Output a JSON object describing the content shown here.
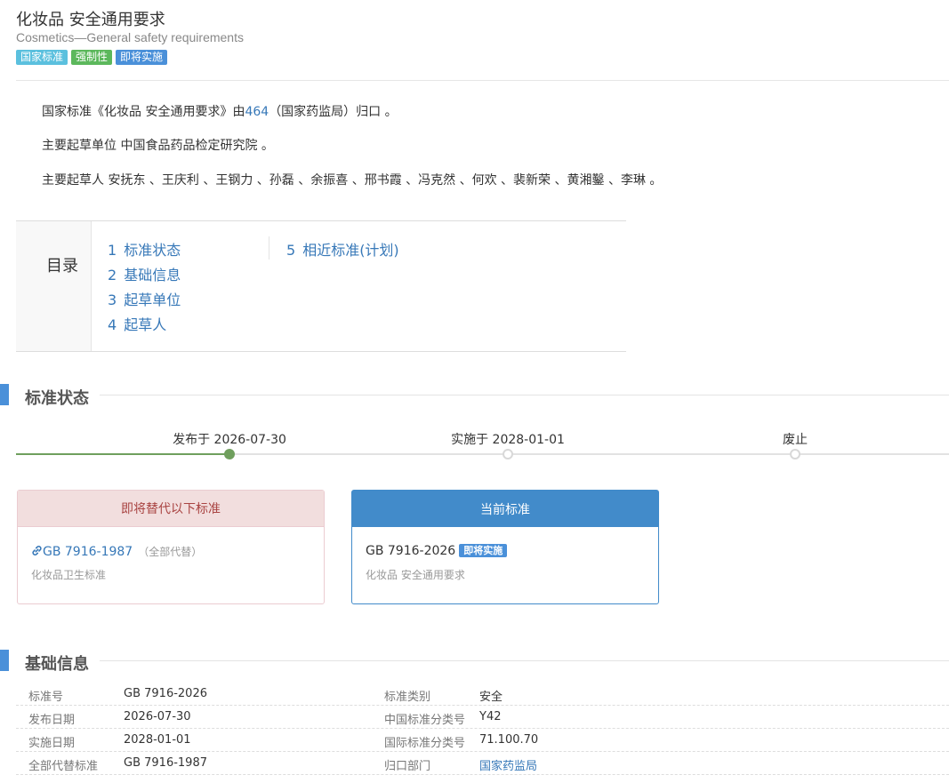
{
  "header": {
    "title": "化妆品 安全通用要求",
    "subtitle": "Cosmetics—General safety requirements",
    "badges": [
      {
        "label": "国家标准",
        "color": "#5bc0de"
      },
      {
        "label": "强制性",
        "color": "#5cb85c"
      },
      {
        "label": "即将实施",
        "color": "#4a90d9"
      }
    ]
  },
  "description": {
    "line1_prefix": "国家标准《化妆品 安全通用要求》由",
    "line1_link": "464",
    "line1_suffix": "（国家药监局）归口 。",
    "line2": "主要起草单位 中国食品药品检定研究院 。",
    "line3": "主要起草人 安抚东 、王庆利 、王钢力 、孙磊 、余振喜 、邢书霞 、冯克然 、何欢 、裴新荣 、黄湘鑿 、李琳 。"
  },
  "toc": {
    "title": "目录",
    "items": [
      {
        "num": "1",
        "label": "标准状态"
      },
      {
        "num": "2",
        "label": "基础信息"
      },
      {
        "num": "3",
        "label": "起草单位"
      },
      {
        "num": "4",
        "label": "起草人"
      },
      {
        "num": "5",
        "label": "相近标准(计划)"
      }
    ]
  },
  "status": {
    "section_title": "标准状态",
    "timeline": [
      {
        "label": "发布于 2026-07-30",
        "done": true
      },
      {
        "label": "实施于 2028-01-01",
        "done": false
      },
      {
        "label": "废止",
        "done": false
      }
    ],
    "replace_card": {
      "header": "即将替代以下标准",
      "code": "GB 7916-1987",
      "note": "（全部代替）",
      "desc": "化妆品卫生标准",
      "header_bg": "#f2dede",
      "header_color": "#a94442",
      "border": "#ebccd1"
    },
    "current_card": {
      "header": "当前标准",
      "code": "GB 7916-2026",
      "badge": "即将实施",
      "desc": "化妆品 安全通用要求",
      "header_bg": "#428bca",
      "border": "#428bca"
    }
  },
  "info": {
    "section_title": "基础信息",
    "rows": [
      {
        "k1": "标准号",
        "v1": "GB 7916-2026",
        "k2": "标准类别",
        "v2": "安全"
      },
      {
        "k1": "发布日期",
        "v1": "2026-07-30",
        "k2": "中国标准分类号",
        "v2": "Y42"
      },
      {
        "k1": "实施日期",
        "v1": "2028-01-01",
        "k2": "国际标准分类号",
        "v2": "71.100.70"
      },
      {
        "k1": "全部代替标准",
        "v1": "GB 7916-1987",
        "k2": "归口部门",
        "v2": "国家药监局"
      }
    ]
  }
}
